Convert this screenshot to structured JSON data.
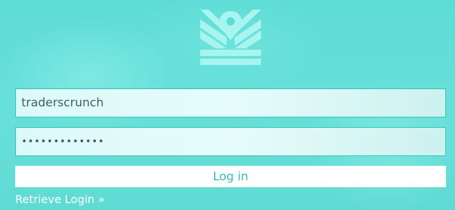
{
  "brand": {
    "logo_icon": "crown-k-pin-logo-icon",
    "logo_color": "#a8f4ef"
  },
  "colors": {
    "background": "#5fdcd6",
    "field_border": "#2ec2b6",
    "button_text": "#2ec3b8"
  },
  "login_form": {
    "username_value": "traderscrunch",
    "password_value": "•••••••••••••",
    "login_button_label": "Log in",
    "retrieve_link_label": "Retrieve Login »"
  }
}
